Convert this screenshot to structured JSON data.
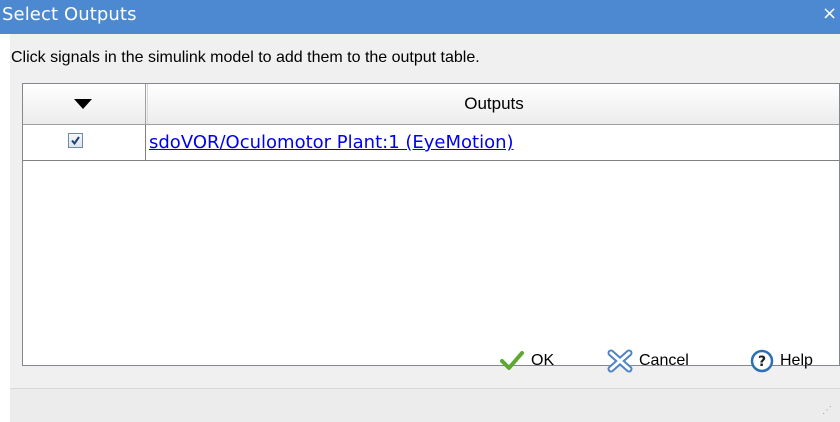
{
  "window": {
    "title": "Select Outputs",
    "close_glyph": "×"
  },
  "instructions": "Click signals in the simulink model to add them to the output table.",
  "table": {
    "columns": [
      "",
      "Outputs"
    ],
    "rows": [
      {
        "checked": true,
        "output": "sdoVOR/Oculomotor Plant:1 (EyeMotion)"
      }
    ]
  },
  "buttons": {
    "ok": "OK",
    "cancel": "Cancel",
    "help": "Help"
  },
  "icons": {
    "ok": "check-icon",
    "cancel": "cross-icon",
    "help": "help-icon",
    "sort": "triangle-down-icon"
  },
  "colors": {
    "titlebar": "#4c89d0",
    "link": "#0000ee",
    "ok_check": "#5da832",
    "cancel_x": "#3b77c0",
    "help_ring": "#2d6fb6"
  }
}
